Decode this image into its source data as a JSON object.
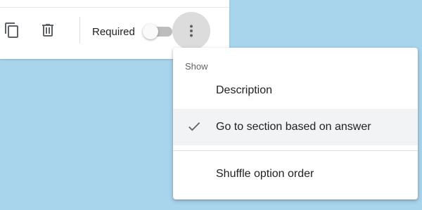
{
  "toolbar": {
    "duplicate_icon": "content-copy-icon",
    "delete_icon": "trash-icon",
    "required_label": "Required",
    "required_on": false,
    "more_icon": "more-vert-icon"
  },
  "menu": {
    "header": "Show",
    "items": [
      {
        "label": "Description",
        "checked": false
      },
      {
        "label": "Go to section based on answer",
        "checked": true
      },
      {
        "label": "Shuffle option order",
        "checked": false
      }
    ]
  },
  "colors": {
    "background": "#a8d4ec",
    "hover_row": "#f1f3f4",
    "icon": "#5f6368"
  }
}
